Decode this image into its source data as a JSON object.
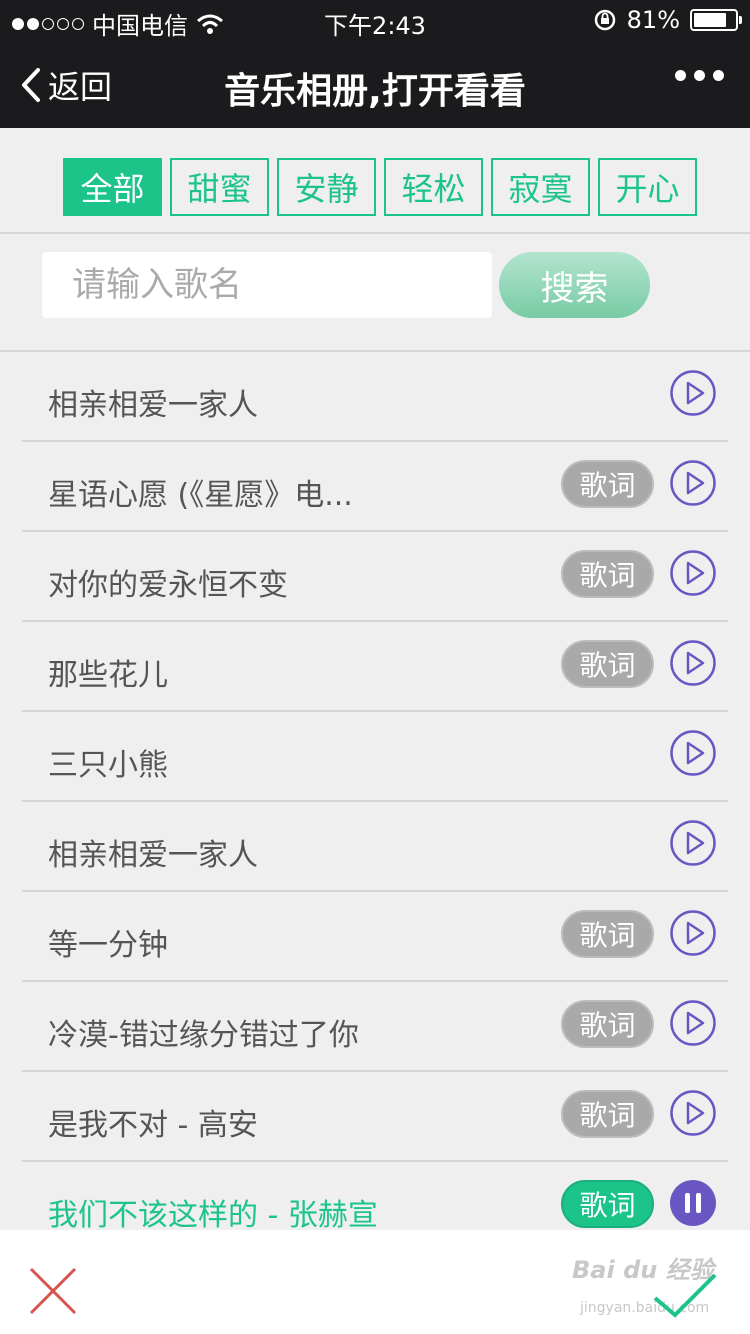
{
  "status_bar": {
    "carrier": "中国电信",
    "time": "下午2:43",
    "battery_percent": "81%",
    "battery_level": 0.81
  },
  "nav": {
    "back_label": "返回",
    "title": "音乐相册,打开看看"
  },
  "tabs": [
    {
      "label": "全部",
      "active": true
    },
    {
      "label": "甜蜜",
      "active": false
    },
    {
      "label": "安静",
      "active": false
    },
    {
      "label": "轻松",
      "active": false
    },
    {
      "label": "寂寞",
      "active": false
    },
    {
      "label": "开心",
      "active": false
    }
  ],
  "search": {
    "placeholder": "请输入歌名",
    "value": "",
    "button_label": "搜索"
  },
  "songs": [
    {
      "title": "相亲相爱一家人",
      "has_lyrics": false,
      "playing": false
    },
    {
      "title": "星语心愿 (《星愿》电...",
      "has_lyrics": true,
      "playing": false
    },
    {
      "title": "对你的爱永恒不变",
      "has_lyrics": true,
      "playing": false
    },
    {
      "title": "那些花儿",
      "has_lyrics": true,
      "playing": false
    },
    {
      "title": "三只小熊",
      "has_lyrics": false,
      "playing": false
    },
    {
      "title": "相亲相爱一家人",
      "has_lyrics": false,
      "playing": false
    },
    {
      "title": "等一分钟",
      "has_lyrics": true,
      "playing": false
    },
    {
      "title": "冷漠-错过缘分错过了你",
      "has_lyrics": true,
      "playing": false
    },
    {
      "title": "是我不对 - 高安",
      "has_lyrics": true,
      "playing": false
    },
    {
      "title": "我们不该这样的 - 张赫宣",
      "has_lyrics": true,
      "playing": true
    }
  ],
  "lyric_label": "歌词",
  "watermark": {
    "text": "Bai du 经验",
    "sub": "jingyan.baidu.com"
  },
  "colors": {
    "accent": "#1dc48a",
    "play_icon": "#6a56c2",
    "close_icon": "#d9534f"
  }
}
